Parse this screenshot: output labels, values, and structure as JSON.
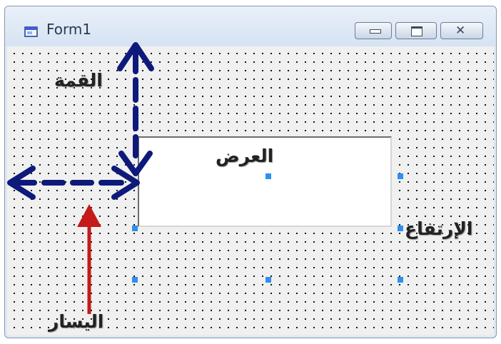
{
  "window": {
    "title": "Form1",
    "buttons": {
      "minimize": "minimize-icon",
      "maximize": "maximize-icon",
      "close": "close-icon",
      "close_glyph": "✕"
    }
  },
  "labels": {
    "top": "القمة",
    "width": "العرض",
    "height": "الإرتفاع",
    "left": "اليسار"
  },
  "colors": {
    "arrow_blue": "#0d1a7a",
    "arrow_red": "#c41a1a",
    "handle": "#2e8ff0"
  }
}
